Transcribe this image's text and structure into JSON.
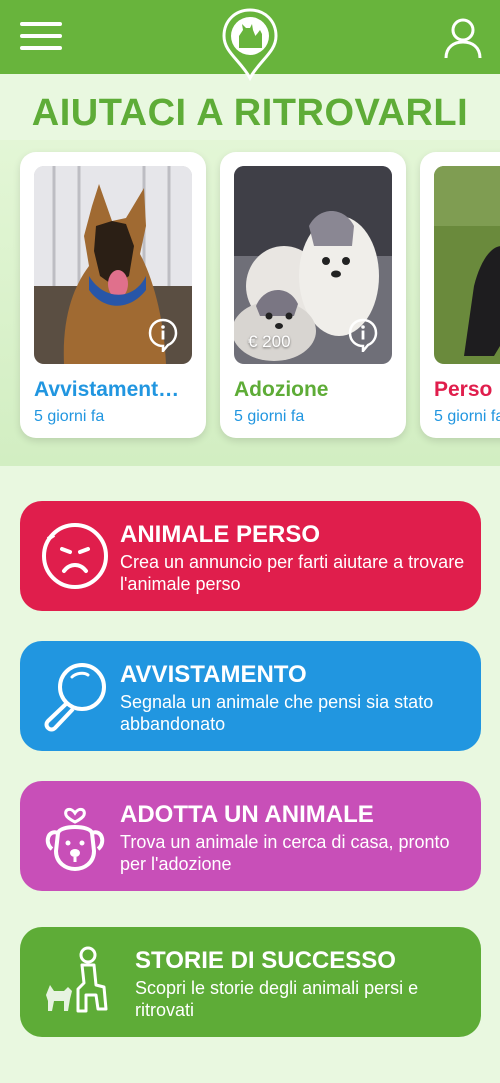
{
  "colors": {
    "brand_green": "#68b43c",
    "title_green": "#5eac37",
    "avvistamento_blue": "#2196e0",
    "adozione_green": "#5eac37",
    "perso_red": "#e01e4c",
    "adotta_magenta": "#c84fb8"
  },
  "header": {
    "menu_icon": "hamburger-menu-icon",
    "logo_icon": "dog-cat-pin-logo",
    "profile_icon": "user-icon"
  },
  "page_title": "AIUTACI A RITROVARLI",
  "cards": [
    {
      "category": "Avvistament…",
      "time": "5 giorni fa",
      "price": "",
      "color": "#2196e0"
    },
    {
      "category": "Adozione",
      "time": "5 giorni fa",
      "price": "€ 200",
      "color": "#5eac37"
    },
    {
      "category": "Perso",
      "time": "5 giorni fa",
      "price": "",
      "color": "#e01e4c"
    }
  ],
  "actions": [
    {
      "title": "ANIMALE PERSO",
      "desc": "Crea un annuncio per farti aiutare a trovare l'animale perso",
      "color": "#e01e4c",
      "icon": "sad-face-icon"
    },
    {
      "title": "AVVISTAMENTO",
      "desc": "Segnala un animale che pensi sia stato abbandonato",
      "color": "#2196e0",
      "icon": "magnifier-icon"
    },
    {
      "title": "ADOTTA UN ANIMALE",
      "desc": "Trova un animale in cerca di casa, pronto per l'adozione",
      "color": "#c84fb8",
      "icon": "dog-heart-icon"
    },
    {
      "title": "STORIE DI SUCCESSO",
      "desc": "Scopri le storie degli animali persi e ritrovati",
      "color": "#5eac37",
      "icon": "person-with-dog-icon"
    }
  ]
}
